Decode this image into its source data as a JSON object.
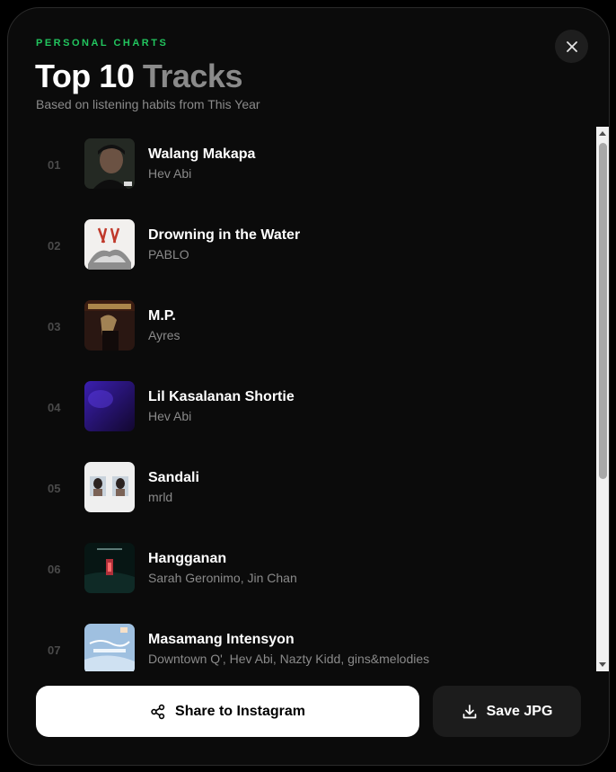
{
  "header": {
    "kicker": "PERSONAL CHARTS",
    "title_main": "Top 10",
    "title_accent": "Tracks",
    "subtitle": "Based on listening habits from This Year"
  },
  "close": {
    "icon": "close-icon"
  },
  "tracks": [
    {
      "rank": "01",
      "name": "Walang Makapa",
      "artist": "Hev Abi"
    },
    {
      "rank": "02",
      "name": "Drowning in the Water",
      "artist": "PABLO"
    },
    {
      "rank": "03",
      "name": "M.P.",
      "artist": "Ayres"
    },
    {
      "rank": "04",
      "name": "Lil Kasalanan Shortie",
      "artist": "Hev Abi"
    },
    {
      "rank": "05",
      "name": "Sandali",
      "artist": "mrld"
    },
    {
      "rank": "06",
      "name": "Hangganan",
      "artist": "Sarah Geronimo, Jin Chan"
    },
    {
      "rank": "07",
      "name": "Masamang Intensyon",
      "artist": "Downtown Q', Hev Abi, Nazty Kidd, gins&melodies"
    }
  ],
  "actions": {
    "share_label": "Share to Instagram",
    "share_icon": "share-icon",
    "save_label": "Save JPG",
    "save_icon": "download-icon"
  },
  "colors": {
    "accent": "#22c55e",
    "background": "#0b0b0b",
    "muted": "#8a8a8a"
  }
}
